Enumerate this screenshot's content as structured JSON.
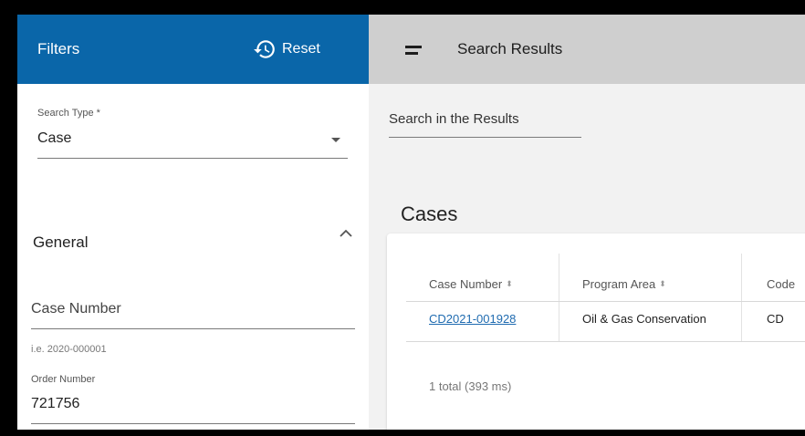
{
  "filters": {
    "title": "Filters",
    "reset_label": "Reset"
  },
  "results_header": {
    "title": "Search Results"
  },
  "sidebar": {
    "search_type": {
      "label": "Search Type *",
      "value": "Case"
    },
    "general": {
      "title": "General",
      "case_number": {
        "placeholder": "Case Number",
        "hint": "i.e. 2020-000001"
      },
      "order_number": {
        "label": "Order Number",
        "value": "721756"
      }
    }
  },
  "main": {
    "search_placeholder": "Search in the Results",
    "cases_title": "Cases",
    "table": {
      "columns": [
        "Case Number",
        "Program Area",
        "Code"
      ],
      "rows": [
        {
          "case_number": "CD2021-001928",
          "program_area": "Oil & Gas Conservation",
          "code": "CD"
        }
      ],
      "total": "1 total (393 ms)"
    }
  },
  "colors": {
    "primary": "#0a66a9",
    "header_gray": "#cfcfcf",
    "link": "#1f6bb0"
  }
}
